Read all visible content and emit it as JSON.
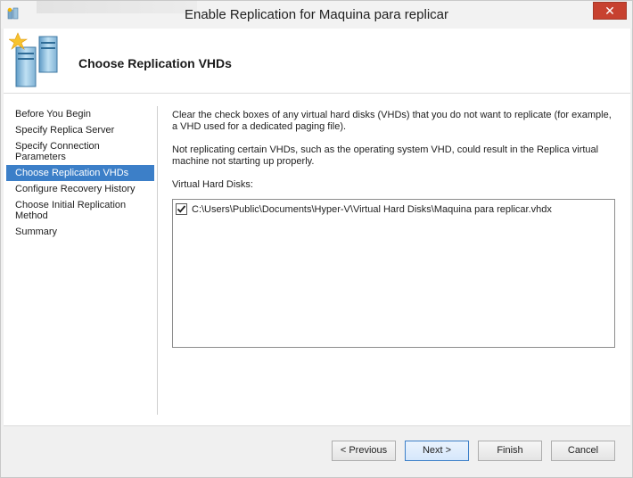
{
  "window": {
    "title": "Enable Replication for Maquina para replicar",
    "close_label": "✕"
  },
  "header": {
    "title": "Choose Replication VHDs"
  },
  "nav": {
    "items": [
      {
        "label": "Before You Begin"
      },
      {
        "label": "Specify Replica Server"
      },
      {
        "label": "Specify Connection Parameters"
      },
      {
        "label": "Choose Replication VHDs",
        "active": true
      },
      {
        "label": "Configure Recovery History"
      },
      {
        "label": "Choose Initial Replication Method"
      },
      {
        "label": "Summary"
      }
    ]
  },
  "content": {
    "intro": "Clear the check boxes of any virtual hard disks (VHDs) that you do not want to replicate (for example, a VHD used for a dedicated paging file).",
    "warning": "Not replicating certain VHDs, such as the operating system VHD, could result in the Replica virtual machine not starting up properly.",
    "vhd_label": "Virtual Hard Disks:",
    "vhds": [
      {
        "path": "C:\\Users\\Public\\Documents\\Hyper-V\\Virtual Hard Disks\\Maquina para replicar.vhdx",
        "checked": true
      }
    ]
  },
  "footer": {
    "previous_label": "< Previous",
    "next_label": "Next >",
    "finish_label": "Finish",
    "cancel_label": "Cancel"
  },
  "colors": {
    "accent": "#3c7fc8",
    "close": "#c7412f"
  }
}
